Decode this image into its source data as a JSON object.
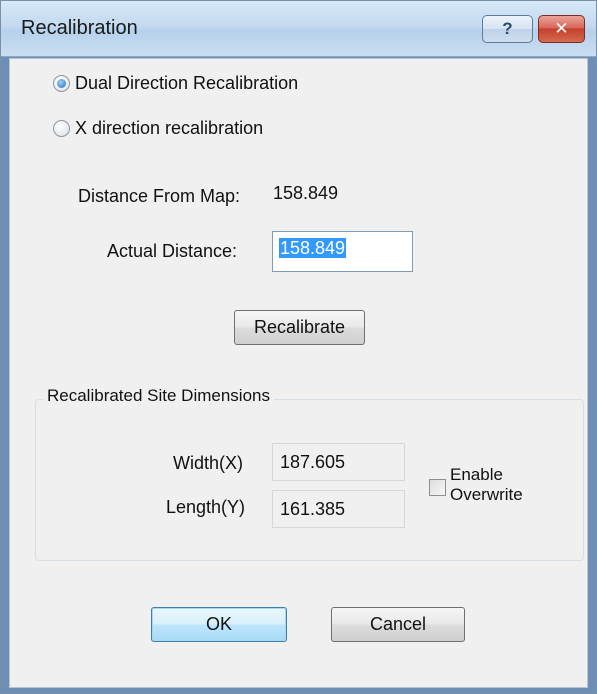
{
  "window": {
    "title": "Recalibration",
    "help_glyph": "?",
    "close_glyph": "✕"
  },
  "mode": {
    "dual_label": "Dual Direction Recalibration",
    "x_label": "X direction recalibration",
    "selected": "dual"
  },
  "distance_from_map": {
    "label": "Distance From Map:",
    "value": "158.849"
  },
  "actual_distance": {
    "label": "Actual Distance:",
    "value": "158.849"
  },
  "recalibrate_button": "Recalibrate",
  "site_dimensions": {
    "legend": "Recalibrated Site Dimensions",
    "width_label": "Width(X)",
    "width_value": "187.605",
    "length_label": "Length(Y)",
    "length_value": "161.385",
    "enable_overwrite_line1": "Enable",
    "enable_overwrite_line2": "Overwrite",
    "enable_overwrite_checked": false
  },
  "footer": {
    "ok_label": "OK",
    "cancel_label": "Cancel"
  },
  "colors": {
    "accent": "#3399ff",
    "close_button": "#c4402e"
  }
}
